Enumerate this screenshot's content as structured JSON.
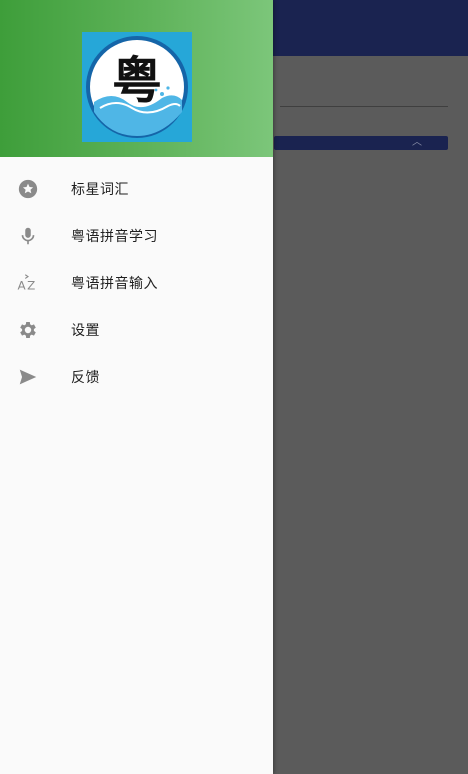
{
  "header": {
    "logo_character": "粤"
  },
  "menu": {
    "items": [
      {
        "icon": "star-circle-icon",
        "label": "标星词汇"
      },
      {
        "icon": "microphone-icon",
        "label": "粤语拼音学习"
      },
      {
        "icon": "az-sort-icon",
        "label": "粤语拼音输入"
      },
      {
        "icon": "gear-icon",
        "label": "设置"
      },
      {
        "icon": "send-icon",
        "label": "反馈"
      }
    ]
  },
  "colors": {
    "header_green_start": "#3e9e3a",
    "header_green_end": "#7cc67a",
    "toolbar_navy": "#1a2350",
    "logo_bg": "#26a7d8",
    "icon_gray": "#8a8a8a",
    "scrim": "#5a5a5a"
  }
}
